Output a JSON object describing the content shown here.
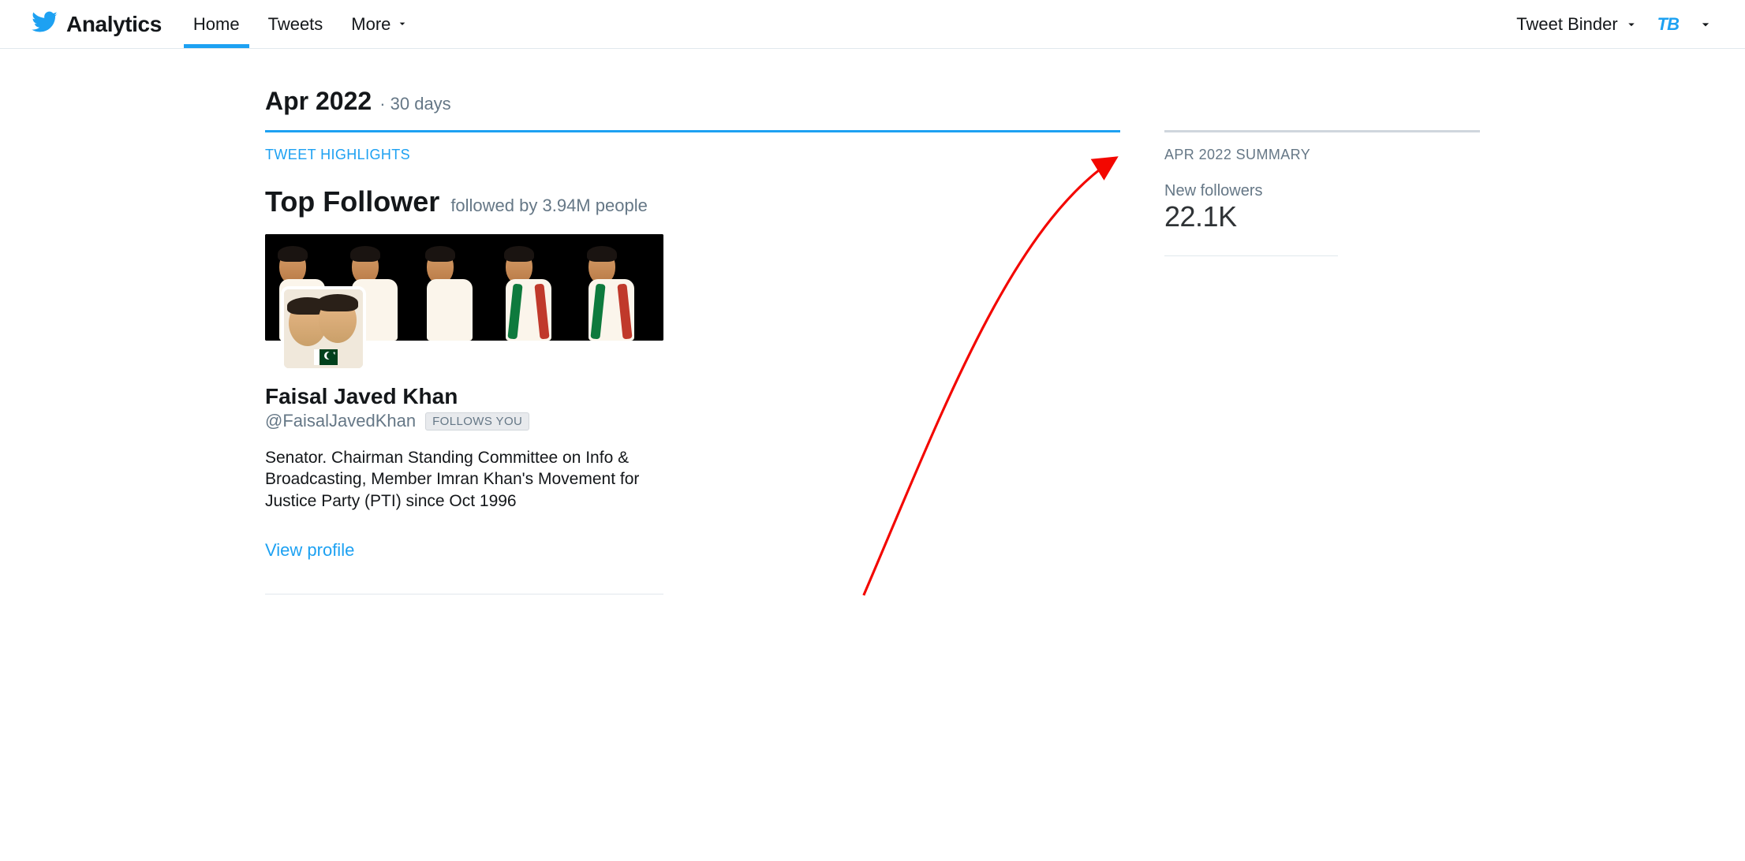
{
  "brand": {
    "title": "Analytics"
  },
  "nav": {
    "home": "Home",
    "tweets": "Tweets",
    "more": "More",
    "account": "Tweet Binder"
  },
  "period": {
    "title": "Apr 2022",
    "subtitle": "· 30 days"
  },
  "highlights_label": "TWEET HIGHLIGHTS",
  "top_follower": {
    "title": "Top Follower",
    "subtitle": "followed by 3.94M people",
    "name": "Faisal Javed Khan",
    "handle": "@FaisalJavedKhan",
    "follows_you": "FOLLOWS YOU",
    "bio": "Senator. Chairman Standing Committee on Info & Broadcasting, Member Imran Khan's Movement for Justice Party (PTI) since Oct 1996",
    "view_profile": "View profile"
  },
  "summary": {
    "label": "APR 2022 SUMMARY",
    "new_followers_label": "New followers",
    "new_followers_value": "22.1K"
  },
  "colors": {
    "accent": "#1da1f2",
    "arrow": "#f30700"
  }
}
